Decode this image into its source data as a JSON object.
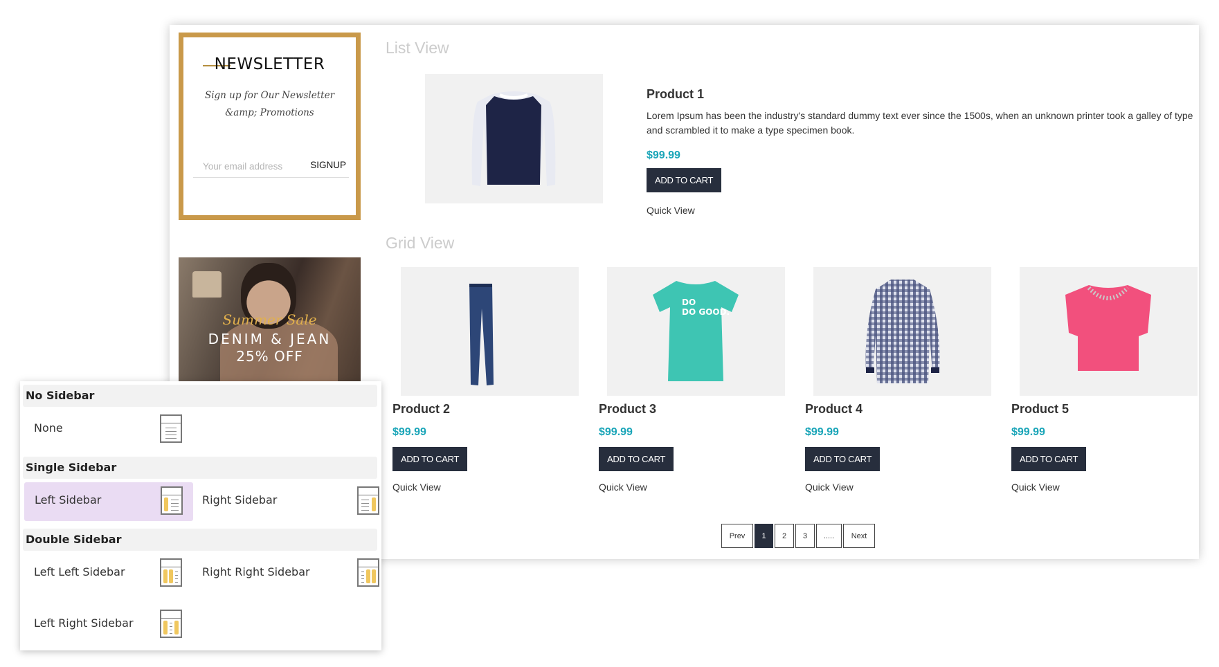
{
  "newsletter": {
    "title": "NEWSLETTER",
    "subtitle": "Sign up for Our Newsletter &amp; Promotions",
    "email_placeholder": "Your email address",
    "signup_label": "SIGNUP"
  },
  "banner": {
    "script_text": "Summer Sale",
    "headline": "DENIM & JEAN",
    "discount": "25% OFF"
  },
  "list_view": {
    "heading": "List View",
    "product": {
      "title": "Product 1",
      "description": "Lorem Ipsum has been the industry's standard dummy text ever since the 1500s, when an unknown printer took a galley of type and scrambled it to make a type specimen book.",
      "price": "$99.99",
      "add_to_cart": "ADD TO CART",
      "quick_view": "Quick View",
      "image": "longsleeve-raglan-shirt"
    }
  },
  "grid_view": {
    "heading": "Grid View",
    "products": [
      {
        "title": "Product 2",
        "price": "$99.99",
        "add_to_cart": "ADD TO CART",
        "quick_view": "Quick View",
        "image": "jeans"
      },
      {
        "title": "Product 3",
        "price": "$99.99",
        "add_to_cart": "ADD TO CART",
        "quick_view": "Quick View",
        "image": "teal-tshirt",
        "image_text": "DO GOOD."
      },
      {
        "title": "Product 4",
        "price": "$99.99",
        "add_to_cart": "ADD TO CART",
        "quick_view": "Quick View",
        "image": "plaid-shirt"
      },
      {
        "title": "Product 5",
        "price": "$99.99",
        "add_to_cart": "ADD TO CART",
        "quick_view": "Quick View",
        "image": "pink-top"
      }
    ]
  },
  "pagination": {
    "prev": "Prev",
    "pages": [
      "1",
      "2",
      "3",
      "....."
    ],
    "current": "1",
    "next": "Next"
  },
  "layout_options": {
    "groups": [
      {
        "heading": "No Sidebar",
        "options": [
          {
            "label": "None",
            "icon": "layout-none-icon"
          }
        ]
      },
      {
        "heading": "Single Sidebar",
        "options": [
          {
            "label": "Left Sidebar",
            "icon": "layout-left-sidebar-icon",
            "selected": true
          },
          {
            "label": "Right Sidebar",
            "icon": "layout-right-sidebar-icon"
          }
        ]
      },
      {
        "heading": "Double Sidebar",
        "options": [
          {
            "label": "Left Left Sidebar",
            "icon": "layout-left-left-sidebar-icon"
          },
          {
            "label": "Right Right Sidebar",
            "icon": "layout-right-right-sidebar-icon"
          },
          {
            "label": "Left Right Sidebar",
            "icon": "layout-left-right-sidebar-icon"
          }
        ]
      }
    ],
    "accent_color": "#f0c75e",
    "selected_bg": "#eadcf3"
  },
  "colors": {
    "newsletter_border": "#c9994a",
    "price": "#1aa5b8",
    "button_bg": "#272e3d"
  }
}
